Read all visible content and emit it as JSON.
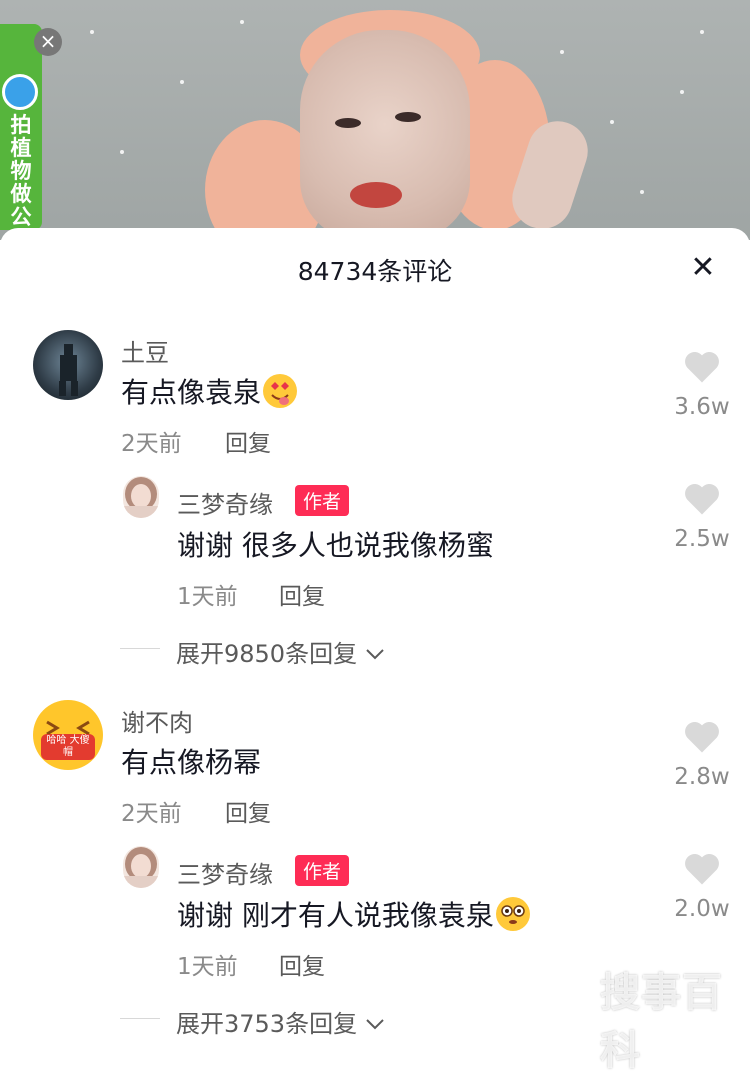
{
  "promo": {
    "label": "拍植物做公益",
    "close": "×"
  },
  "sheet": {
    "title": "84734条评论",
    "close": "✕"
  },
  "comments": [
    {
      "user": "土豆",
      "text": "有点像袁泉",
      "emoji": "heart-eyes-tongue-emoji",
      "time": "2天前",
      "reply_label": "回复",
      "likes": "3.6w",
      "reply": {
        "user": "三梦奇缘",
        "badge": "作者",
        "text": "谢谢 很多人也说我像杨蜜",
        "time": "1天前",
        "reply_label": "回复",
        "likes": "2.5w"
      },
      "expand": "展开9850条回复"
    },
    {
      "user": "谢不肉",
      "avatar_text": "哈哈 大傻帽",
      "text": "有点像杨幂",
      "time": "2天前",
      "reply_label": "回复",
      "likes": "2.8w",
      "reply": {
        "user": "三梦奇缘",
        "badge": "作者",
        "text": "谢谢 刚才有人说我像袁泉",
        "emoji": "flushed-emoji",
        "time": "1天前",
        "reply_label": "回复",
        "likes": "2.0w"
      },
      "expand": "展开3753条回复"
    }
  ],
  "watermark": "搜事百科",
  "colors": {
    "author_badge": "#fe2c55",
    "promo_green": "#56b53c"
  }
}
